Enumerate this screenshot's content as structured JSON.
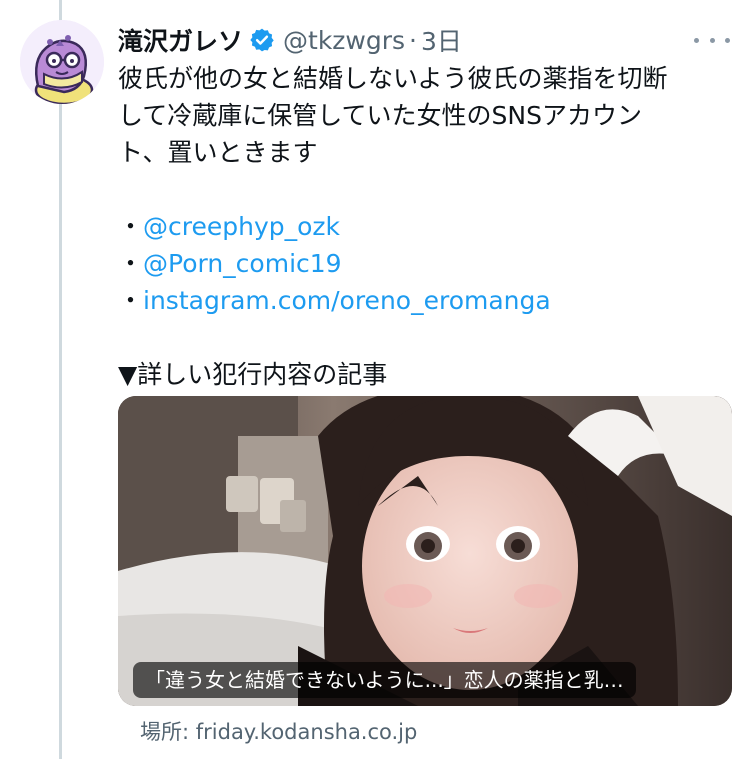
{
  "tweet": {
    "display_name": "滝沢ガレソ",
    "handle": "@tkzwgrs",
    "separator": "·",
    "time": "3日",
    "text_lines": [
      "彼氏が他の女と結婚しないよう彼氏の薬指を切断",
      "して冷蔵庫に保管していた女性のSNSアカウン",
      "ト、置いときます"
    ],
    "links": [
      {
        "bullet": "・",
        "text": "@creephyp_ozk"
      },
      {
        "bullet": "・",
        "text": "@Porn_comic19"
      },
      {
        "bullet": "・",
        "text": "instagram.com/oreno_eromanga"
      }
    ],
    "article_heading": "▼詳しい犯行内容の記事",
    "card": {
      "caption": "「違う女と結婚できないように...」恋人の薬指と乳…",
      "source": "場所: friday.kodansha.co.jp"
    },
    "icons": {
      "avatar": "cartoon-snake-avatar",
      "verified": "verified-badge-icon",
      "more": "more-options-icon"
    },
    "colors": {
      "link": "#1d9bf0",
      "secondary_text": "#536471",
      "thread_line": "#cfd9de"
    }
  }
}
